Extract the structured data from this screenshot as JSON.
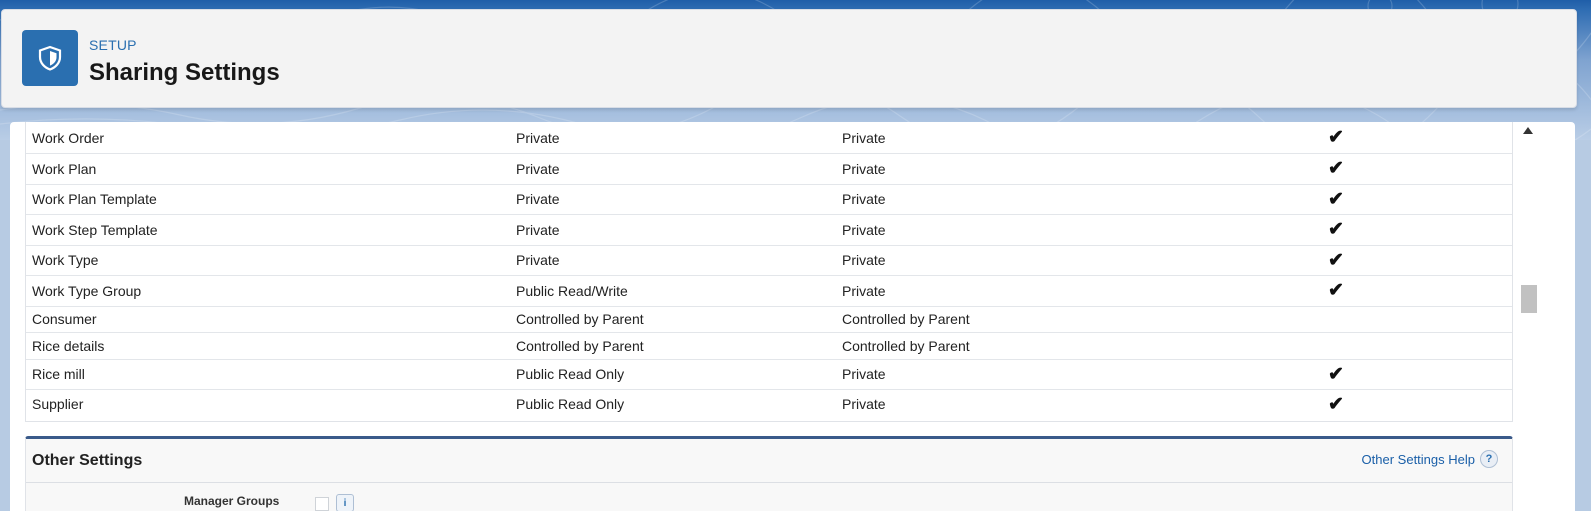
{
  "header": {
    "eyebrow": "SETUP",
    "title": "Sharing Settings",
    "icon": "shield-icon"
  },
  "colors": {
    "brand": "#2a6fb0",
    "link": "#1a5fa8",
    "section_rule": "#3a5a8a"
  },
  "sharing_rows": [
    {
      "name": "Work Order",
      "internal": "Private",
      "external": "Private",
      "checked": true
    },
    {
      "name": "Work Plan",
      "internal": "Private",
      "external": "Private",
      "checked": true
    },
    {
      "name": "Work Plan Template",
      "internal": "Private",
      "external": "Private",
      "checked": true
    },
    {
      "name": "Work Step Template",
      "internal": "Private",
      "external": "Private",
      "checked": true
    },
    {
      "name": "Work Type",
      "internal": "Private",
      "external": "Private",
      "checked": true
    },
    {
      "name": "Work Type Group",
      "internal": "Public Read/Write",
      "external": "Private",
      "checked": true
    },
    {
      "name": "Consumer",
      "internal": "Controlled by Parent",
      "external": "Controlled by Parent",
      "checked": false
    },
    {
      "name": "Rice details",
      "internal": "Controlled by Parent",
      "external": "Controlled by Parent",
      "checked": false
    },
    {
      "name": "Rice mill",
      "internal": "Public Read Only",
      "external": "Private",
      "checked": true
    },
    {
      "name": "Supplier",
      "internal": "Public Read Only",
      "external": "Private",
      "checked": true
    }
  ],
  "check_glyph": "✔",
  "other_settings": {
    "title": "Other Settings",
    "help_link": "Other Settings Help",
    "help_icon": "?",
    "manager_groups_label": "Manager Groups",
    "info_icon": "i"
  }
}
